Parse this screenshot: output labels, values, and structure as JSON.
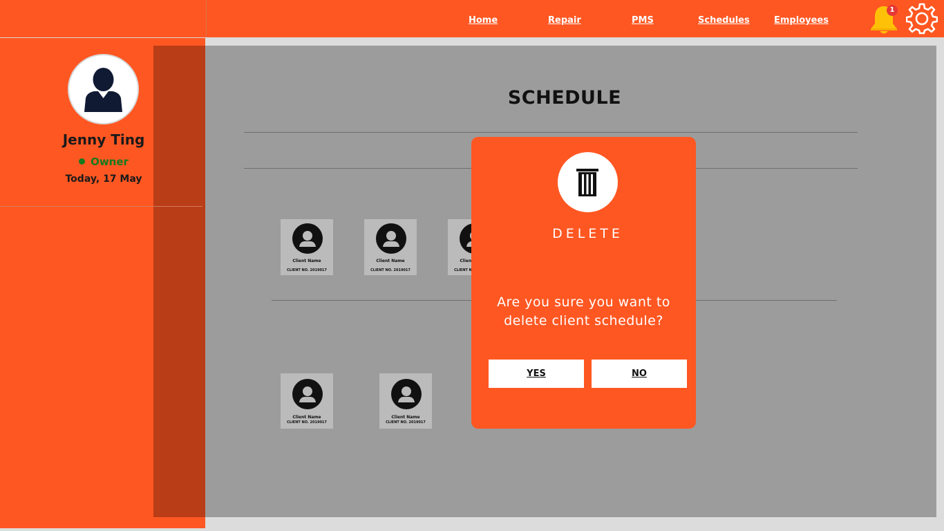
{
  "nav": {
    "links": [
      "Home",
      "Repair",
      "PMS",
      "Schedules",
      "Employees"
    ],
    "notification_count": "1"
  },
  "profile": {
    "name": "Jenny Ting",
    "role": "Owner",
    "date": "Today, 17 May"
  },
  "page": {
    "title": "SCHEDULE"
  },
  "clients": [
    {
      "name": "Client Name",
      "number": "CLIENT NO. 2019017"
    },
    {
      "name": "Client Name",
      "number": "CLIENT NO. 2019017"
    },
    {
      "name": "Client Name",
      "number": "CLIENT NO. 2019017"
    },
    {
      "name": "Client Name",
      "number": "CLIENT NO. 2019017"
    },
    {
      "name": "Client Name",
      "number": "CLIENT NO. 2019017"
    }
  ],
  "modal": {
    "title": "DELETE",
    "message": "Are you sure you want to delete client schedule?",
    "yes_label": "YES",
    "no_label": "NO"
  },
  "colors": {
    "brand": "#ff5722",
    "sidebar_shade": "#b93d17",
    "overlay": "#9c9c9c",
    "status_green": "#177a1d",
    "badge_red": "#e53935",
    "bell_yellow": "#ffc107"
  },
  "icons": [
    "bell-icon",
    "gear-icon",
    "user-avatar-icon",
    "client-avatar-icon",
    "trash-icon"
  ]
}
